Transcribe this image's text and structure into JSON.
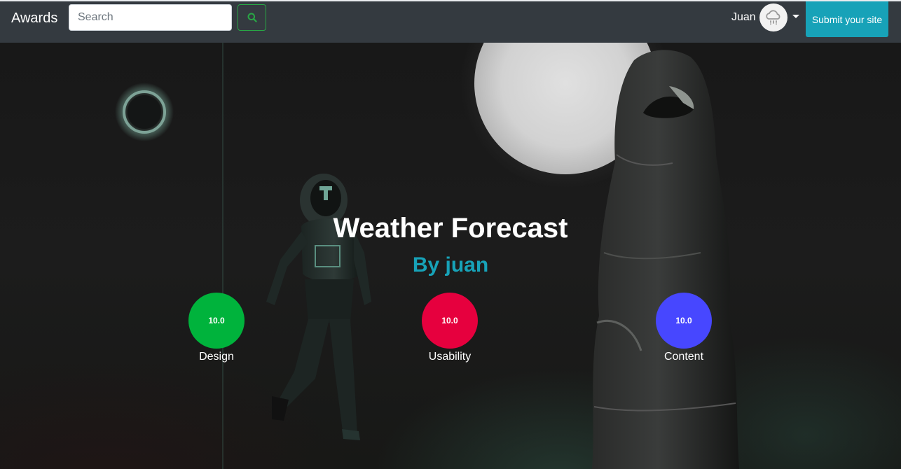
{
  "navbar": {
    "brand": "Awards",
    "search": {
      "placeholder": "Search",
      "value": ""
    },
    "user": {
      "name": "Juan"
    },
    "submit_label": "Submit your site"
  },
  "hero": {
    "title": "Weather Forecast",
    "author": "By juan",
    "scores": [
      {
        "label": "Design",
        "value": "10.0",
        "color": "#00b33c"
      },
      {
        "label": "Usability",
        "value": "10.0",
        "color": "#e6003e"
      },
      {
        "label": "Content",
        "value": "10.0",
        "color": "#4747ff"
      }
    ]
  },
  "icons": {
    "search_button": "search-icon",
    "avatar": "cloud-rain-icon",
    "dropdown": "caret-down-icon"
  },
  "colors": {
    "navbar_bg": "#343a40",
    "accent": "#17a2b8",
    "search_outline": "#28a745"
  }
}
